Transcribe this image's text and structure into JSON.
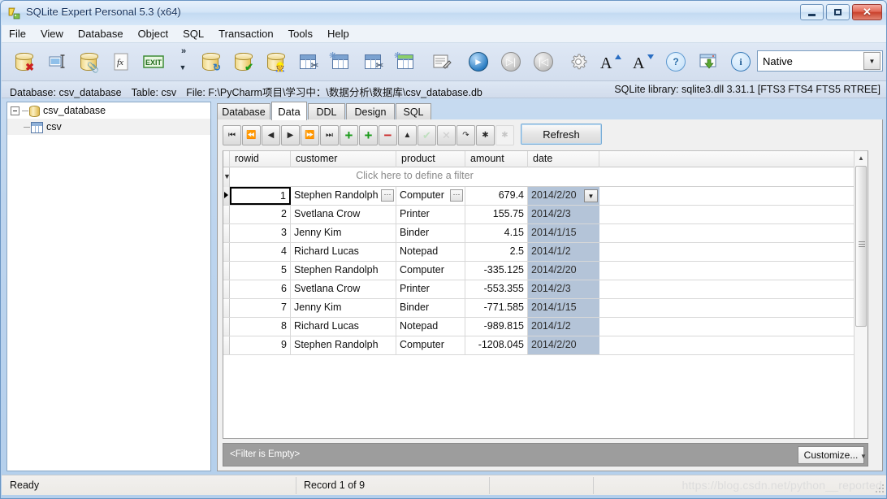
{
  "window": {
    "title": "SQLite Expert Personal 5.3 (x64)",
    "app_icon": "sqlite-expert-icon",
    "minimize_label": "–",
    "maximize_label": "□",
    "close_label": "✕"
  },
  "menu": {
    "items": [
      {
        "name": "file",
        "label": "File"
      },
      {
        "name": "view",
        "label": "View"
      },
      {
        "name": "database",
        "label": "Database"
      },
      {
        "name": "object",
        "label": "Object"
      },
      {
        "name": "sql",
        "label": "SQL"
      },
      {
        "name": "transaction",
        "label": "Transaction"
      },
      {
        "name": "tools",
        "label": "Tools"
      },
      {
        "name": "help",
        "label": "Help"
      }
    ]
  },
  "toolbar": {
    "overflow_chevron": "»",
    "overflow_arrow": "▼",
    "encoding_combo": {
      "value": "Native",
      "arrow": "▼"
    },
    "buttons": [
      {
        "name": "close-database-button",
        "icon": "database-delete-icon",
        "badge": "✖"
      },
      {
        "name": "rename-button",
        "icon": "rename-field-icon",
        "badge": ""
      },
      {
        "name": "attach-database-button",
        "icon": "database-attach-icon",
        "badge": ""
      },
      {
        "name": "user-function-button",
        "icon": "function-fx-icon",
        "badge": ""
      },
      {
        "name": "exit-button",
        "icon": "exit-icon",
        "badge": ""
      },
      {
        "name": "refresh-database-button",
        "icon": "database-refresh-icon",
        "badge": ""
      },
      {
        "name": "verify-database-button",
        "icon": "database-check-icon",
        "badge": "✔"
      },
      {
        "name": "repair-database-button",
        "icon": "database-repair-icon",
        "badge": ""
      },
      {
        "name": "drop-table-button",
        "icon": "table-delete-icon",
        "badge": ""
      },
      {
        "name": "new-table-button",
        "icon": "table-new-icon",
        "badge": ""
      },
      {
        "name": "delete-records-button",
        "icon": "table-rows-delete-icon",
        "badge": ""
      },
      {
        "name": "new-view-button",
        "icon": "view-new-icon",
        "badge": ""
      },
      {
        "name": "edit-sql-button",
        "icon": "sql-edit-icon",
        "badge": ""
      },
      {
        "name": "execute-button",
        "icon": "play-icon",
        "badge": "▶"
      },
      {
        "name": "execute-step-button",
        "icon": "step-forward-icon",
        "badge": "▶│"
      },
      {
        "name": "execute-back-button",
        "icon": "step-back-icon",
        "badge": "│◀"
      },
      {
        "name": "options-button",
        "icon": "gear-icon",
        "badge": ""
      },
      {
        "name": "increase-font-button",
        "icon": "font-increase-icon",
        "badge": "A"
      },
      {
        "name": "decrease-font-button",
        "icon": "font-decrease-icon",
        "badge": "A"
      },
      {
        "name": "help-button",
        "icon": "help-question-icon",
        "badge": "?"
      },
      {
        "name": "import-button",
        "icon": "import-window-icon",
        "badge": ""
      },
      {
        "name": "about-button",
        "icon": "info-icon",
        "badge": "i"
      }
    ]
  },
  "info_bar": {
    "database_label": "Database: csv_database",
    "table_label": "Table: csv",
    "file_label": "File: F:\\PyCharm项目\\学习中：\\数据分析\\数据库\\csv_database.db",
    "library_label": "SQLite library: sqlite3.dll 3.31.1 [FTS3 FTS4 FTS5 RTREE]"
  },
  "sidebar": {
    "tree": [
      {
        "name": "tree-node-database",
        "label": "csv_database",
        "icon": "database-icon",
        "expander": "−"
      },
      {
        "name": "tree-node-table",
        "label": "csv",
        "icon": "table-icon",
        "selected": true
      }
    ]
  },
  "tabs": [
    {
      "name": "tab-database",
      "label": "Database",
      "active": false
    },
    {
      "name": "tab-data",
      "label": "Data",
      "active": true
    },
    {
      "name": "tab-ddl",
      "label": "DDL",
      "active": false
    },
    {
      "name": "tab-design",
      "label": "Design",
      "active": false
    },
    {
      "name": "tab-sql",
      "label": "SQL",
      "active": false
    }
  ],
  "nav_toolbar": {
    "refresh_label": "Refresh",
    "buttons": [
      {
        "name": "first-record-button",
        "glyph": "⏮",
        "state": "enabled"
      },
      {
        "name": "prior-page-button",
        "glyph": "⏪",
        "state": "enabled"
      },
      {
        "name": "prior-record-button",
        "glyph": "◀",
        "state": "enabled"
      },
      {
        "name": "next-record-button",
        "glyph": "▶",
        "state": "enabled"
      },
      {
        "name": "next-page-button",
        "glyph": "⏩",
        "state": "enabled"
      },
      {
        "name": "last-record-button",
        "glyph": "⏭",
        "state": "enabled"
      },
      {
        "name": "insert-record-button",
        "glyph": "+",
        "state": "enabled"
      },
      {
        "name": "duplicate-record-button",
        "glyph": "+",
        "state": "enabled"
      },
      {
        "name": "delete-record-button",
        "glyph": "−",
        "state": "enabled"
      },
      {
        "name": "edit-record-button",
        "glyph": "▲",
        "state": "enabled"
      },
      {
        "name": "post-edit-button",
        "glyph": "✔",
        "state": "disabled"
      },
      {
        "name": "cancel-edit-button",
        "glyph": "✕",
        "state": "disabled"
      },
      {
        "name": "refresh-record-button",
        "glyph": "↷",
        "state": "enabled"
      },
      {
        "name": "set-null-button",
        "glyph": "✱",
        "state": "enabled"
      },
      {
        "name": "clear-null-button",
        "glyph": "✱",
        "state": "disabled"
      }
    ]
  },
  "grid": {
    "columns": [
      {
        "name": "column-rowid",
        "label": "rowid",
        "align": "right"
      },
      {
        "name": "column-customer",
        "label": "customer",
        "align": "left"
      },
      {
        "name": "column-product",
        "label": "product",
        "align": "left"
      },
      {
        "name": "column-amount",
        "label": "amount",
        "align": "right"
      },
      {
        "name": "column-date",
        "label": "date",
        "align": "left"
      }
    ],
    "filter_row_text": "Click here to define a filter",
    "ellipsis_label": "···",
    "date_dropdown_label": "▼",
    "rows": [
      {
        "rowid": "1",
        "customer": "Stephen Randolph",
        "product": "Computer",
        "amount": "679.4",
        "date": "2014/2/20",
        "selected": true
      },
      {
        "rowid": "2",
        "customer": "Svetlana Crow",
        "product": "Printer",
        "amount": "155.75",
        "date": "2014/2/3",
        "selected": false
      },
      {
        "rowid": "3",
        "customer": "Jenny Kim",
        "product": "Binder",
        "amount": "4.15",
        "date": "2014/1/15",
        "selected": false
      },
      {
        "rowid": "4",
        "customer": "Richard Lucas",
        "product": "Notepad",
        "amount": "2.5",
        "date": "2014/1/2",
        "selected": false
      },
      {
        "rowid": "5",
        "customer": "Stephen Randolph",
        "product": "Computer",
        "amount": "-335.125",
        "date": "2014/2/20",
        "selected": false
      },
      {
        "rowid": "6",
        "customer": "Svetlana Crow",
        "product": "Printer",
        "amount": "-553.355",
        "date": "2014/2/3",
        "selected": false
      },
      {
        "rowid": "7",
        "customer": "Jenny Kim",
        "product": "Binder",
        "amount": "-771.585",
        "date": "2014/1/15",
        "selected": false
      },
      {
        "rowid": "8",
        "customer": "Richard Lucas",
        "product": "Notepad",
        "amount": "-989.815",
        "date": "2014/1/2",
        "selected": false
      },
      {
        "rowid": "9",
        "customer": "Stephen Randolph",
        "product": "Computer",
        "amount": "-1208.045",
        "date": "2014/2/20",
        "selected": false
      }
    ]
  },
  "filter_strip": {
    "text": "<Filter is Empty>",
    "customize_label": "Customize..."
  },
  "status_bar": {
    "ready": "Ready",
    "record": "Record 1 of 9",
    "watermark": "https://blog.csdn.net/python__reported"
  },
  "colors": {
    "title_accent": "#16325c",
    "close_button": "#c9412c",
    "date_cell": "#b4c4d8",
    "filter_strip": "#9d9d9d",
    "refresh_focus": "#7aaed8"
  }
}
